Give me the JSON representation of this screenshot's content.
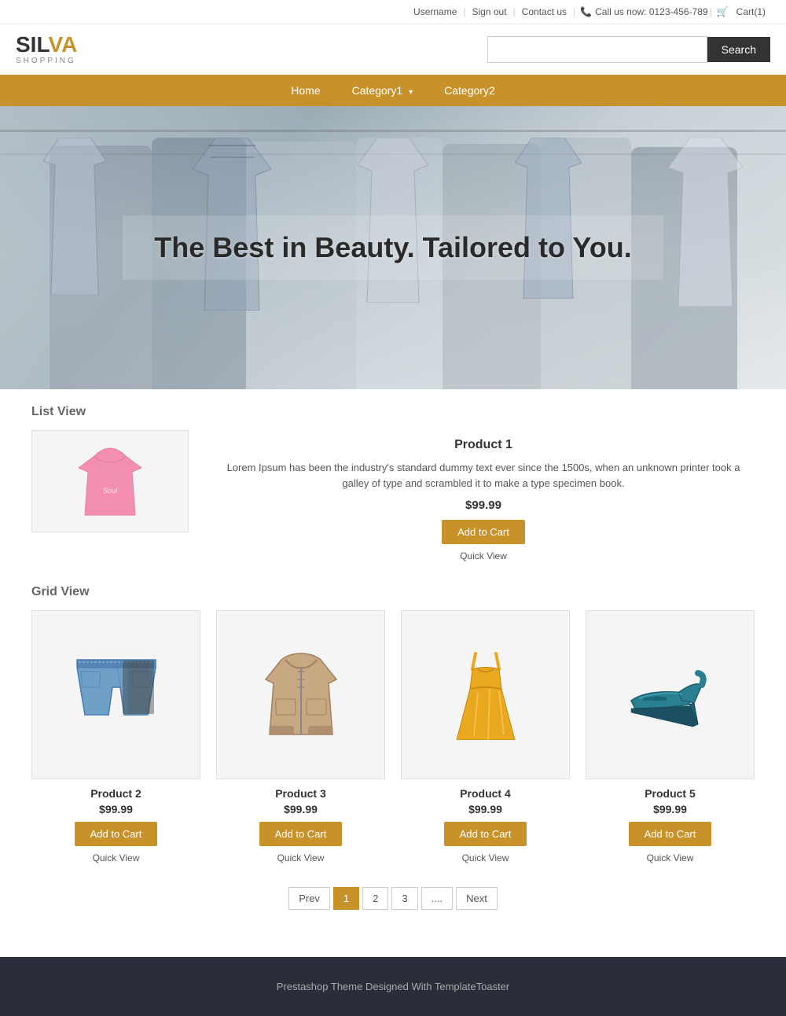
{
  "topbar": {
    "username": "Username",
    "signout": "Sign out",
    "contact": "Contact us",
    "phone_label": "Call us now: 0123-456-789",
    "cart": "Cart(1)"
  },
  "header": {
    "logo_sil": "SIL",
    "logo_va": "VA",
    "logo_sub": "SHOPPING",
    "search_placeholder": "",
    "search_button": "Search"
  },
  "nav": {
    "items": [
      {
        "label": "Home",
        "has_dropdown": false
      },
      {
        "label": "Category1",
        "has_dropdown": true
      },
      {
        "label": "Category2",
        "has_dropdown": false
      }
    ]
  },
  "hero": {
    "text": "The Best in Beauty. Tailored to You."
  },
  "list_view": {
    "title": "List View",
    "product": {
      "name": "Product 1",
      "description": "Lorem Ipsum has been the industry's standard dummy text ever since the 1500s, when an unknown printer took a galley of type and scrambled it to make a type specimen book.",
      "price": "$99.99",
      "add_to_cart": "Add to Cart",
      "quick_view": "Quick View"
    }
  },
  "grid_view": {
    "title": "Grid View",
    "products": [
      {
        "name": "Product 2",
        "price": "$99.99",
        "add_to_cart": "Add to Cart",
        "quick_view": "Quick View"
      },
      {
        "name": "Product 3",
        "price": "$99.99",
        "add_to_cart": "Add to Cart",
        "quick_view": "Quick View"
      },
      {
        "name": "Product 4",
        "price": "$99.99",
        "add_to_cart": "Add to Cart",
        "quick_view": "Quick View"
      },
      {
        "name": "Product 5",
        "price": "$99.99",
        "add_to_cart": "Add to Cart",
        "quick_view": "Quick View"
      }
    ]
  },
  "pagination": {
    "prev": "Prev",
    "pages": [
      "1",
      "2",
      "3",
      "...."
    ],
    "next": "Next",
    "active": "1"
  },
  "footer": {
    "text": "Prestashop Theme Designed With TemplateToaster"
  }
}
